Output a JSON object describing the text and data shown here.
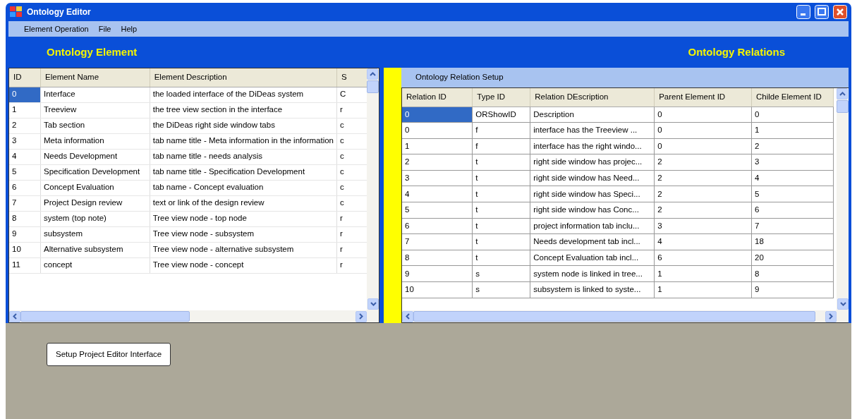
{
  "window": {
    "title": "Ontology Editor"
  },
  "menu": [
    "Element Operation",
    "File",
    "Help"
  ],
  "element_panel": {
    "title": "Ontology Element",
    "table": {
      "columns": [
        "ID",
        "Element Name",
        "Element Description",
        "S"
      ],
      "rows": [
        {
          "cells": [
            "0",
            "Interface",
            "the loaded interface of the DiDeas system",
            "C"
          ],
          "selected": true
        },
        {
          "cells": [
            "1",
            "Treeview",
            "the tree view section in the interface",
            "r"
          ],
          "selected": false
        },
        {
          "cells": [
            "2",
            "Tab section",
            "the DiDeas right side window tabs",
            "c"
          ],
          "selected": false
        },
        {
          "cells": [
            "3",
            "Meta information",
            "tab name title  - Meta information in the information",
            "c"
          ],
          "selected": false
        },
        {
          "cells": [
            "4",
            "Needs Development",
            "tab name title  -  needs analysis",
            "c"
          ],
          "selected": false
        },
        {
          "cells": [
            "5",
            "Specification Development",
            "tab name title  - Specification Development",
            "c"
          ],
          "selected": false
        },
        {
          "cells": [
            "6",
            "Concept Evaluation",
            "tab name - Concept evaluation",
            "c"
          ],
          "selected": false
        },
        {
          "cells": [
            "7",
            "Project Design review",
            "text or link of the design review",
            "c"
          ],
          "selected": false
        },
        {
          "cells": [
            "8",
            "system (top note)",
            "Tree view node - top node",
            "r"
          ],
          "selected": false
        },
        {
          "cells": [
            "9",
            "subsystem",
            "Tree view node - subsystem",
            "r"
          ],
          "selected": false
        },
        {
          "cells": [
            "10",
            "Alternative subsystem",
            "Tree view node - alternative subsystem",
            "r"
          ],
          "selected": false
        },
        {
          "cells": [
            "11",
            "concept",
            "Tree view node - concept",
            "r"
          ],
          "selected": false
        }
      ]
    }
  },
  "relations_panel": {
    "title": "Ontology Relations",
    "section_title": "Ontology Relation Setup",
    "table": {
      "columns": [
        "Relation ID",
        "Type ID",
        "Relation DEscription",
        "Parent Element ID",
        "Childe Element ID"
      ],
      "rows": [
        {
          "cells": [
            "0",
            "ORShowID",
            "Description",
            "0",
            "0"
          ],
          "selected": true
        },
        {
          "cells": [
            "0",
            "f",
            "interface has the Treeview ...",
            "0",
            "1"
          ],
          "selected": false
        },
        {
          "cells": [
            "1",
            "f",
            "interface has the right windo...",
            "0",
            "2"
          ],
          "selected": false
        },
        {
          "cells": [
            "2",
            "t",
            "right side window has projec...",
            "2",
            "3"
          ],
          "selected": false
        },
        {
          "cells": [
            "3",
            "t",
            "right side window has Need...",
            "2",
            "4"
          ],
          "selected": false
        },
        {
          "cells": [
            "4",
            "t",
            "right side window has Speci...",
            "2",
            "5"
          ],
          "selected": false
        },
        {
          "cells": [
            "5",
            "t",
            "right side window has Conc...",
            "2",
            "6"
          ],
          "selected": false
        },
        {
          "cells": [
            "6",
            "t",
            "project information tab inclu...",
            "3",
            "7"
          ],
          "selected": false
        },
        {
          "cells": [
            "7",
            "t",
            "Needs development tab incl...",
            "4",
            "18"
          ],
          "selected": false
        },
        {
          "cells": [
            "8",
            "t",
            "Concept Evaluation tab incl...",
            "6",
            "20"
          ],
          "selected": false
        },
        {
          "cells": [
            "9",
            "s",
            "system node is linked in tree...",
            "1",
            "8"
          ],
          "selected": false
        },
        {
          "cells": [
            "10",
            "s",
            "subsystem is linked to syste...",
            "1",
            "9"
          ],
          "selected": false
        }
      ]
    }
  },
  "buttons": [
    "Setup Project Editor Interface"
  ]
}
